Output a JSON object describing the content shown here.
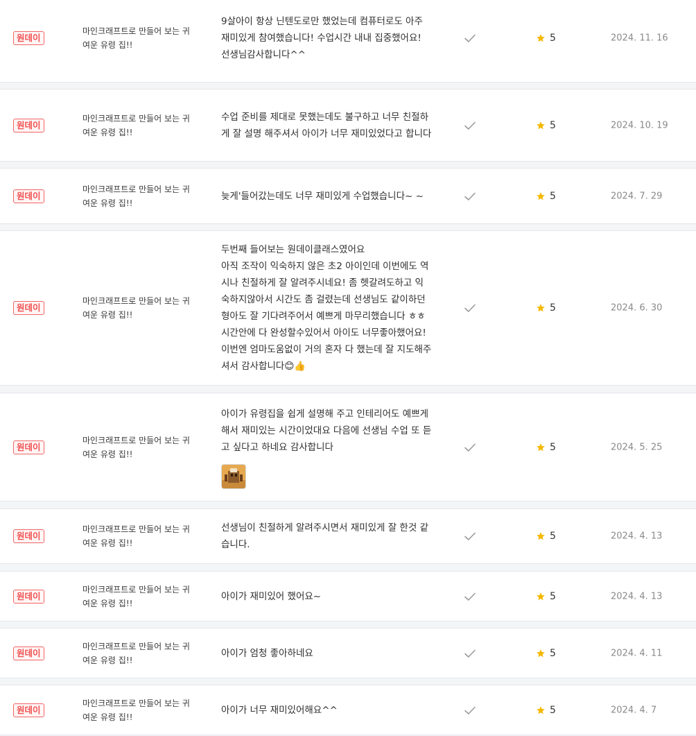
{
  "reviews": [
    {
      "badge": "원데이",
      "title": "마인크래프트로 만들어 보는 귀여운 유령 집!!",
      "text": [
        "9살아이 항상 닌텐도로만 했었는데 컴퓨터로도 아주 재미있게 참여했습니다! 수업시간 내내 집중했어요!",
        "선생님감사합니다^^"
      ],
      "rating": "5",
      "date": "2024. 11. 16",
      "has_image": false
    },
    {
      "badge": "원데이",
      "title": "마인크래프트로 만들어 보는 귀여운 유령 집!!",
      "text": [
        "수업 준비를 제대로 못했는데도 불구하고 너무 친절하게 잘 설명 해주셔서 아이가 너무 재미있었다고 합니다"
      ],
      "rating": "5",
      "date": "2024. 10. 19",
      "has_image": false
    },
    {
      "badge": "원데이",
      "title": "마인크래프트로 만들어 보는 귀여운 유령 집!!",
      "text": [
        "늦게'들어갔는데도 너무 재미있게 수업했습니다~ ~"
      ],
      "rating": "5",
      "date": "2024. 7. 29",
      "has_image": false
    },
    {
      "badge": "원데이",
      "title": "마인크래프트로 만들어 보는 귀여운 유령 집!!",
      "text": [
        "두번째 들어보는 원데이클래스였어요",
        "아직 조작이 익숙하지 않은 초2 아이인데 이번에도 역시나 친절하게 잘 알려주시네요! 좀 헷갈려도하고 익숙하지않아서 시간도 좀 걸렸는데 선생님도 같이하던 형아도 잘 기다려주어서 예쁘게 마무리했습니다 ㅎㅎ 시간안에 다 완성할수있어서 아이도 너무좋아했어요! 이번엔 엄마도움없이 거의 혼자 다 했는데 잘 지도해주셔서 감사합니다😊👍"
      ],
      "rating": "5",
      "date": "2024. 6. 30",
      "has_image": false
    },
    {
      "badge": "원데이",
      "title": "마인크래프트로 만들어 보는 귀여운 유령 집!!",
      "text": [
        "아이가 유령집을 쉽게 설명해 주고 인테리어도 예쁘게 해서 재미있는 시간이었대요 다음에 선생님 수업 또 듣고 싶다고 하네요 감사합니다"
      ],
      "rating": "5",
      "date": "2024. 5. 25",
      "has_image": true
    },
    {
      "badge": "원데이",
      "title": "마인크래프트로 만들어 보는 귀여운 유령 집!!",
      "text": [
        "선생님이 친절하게 알려주시면서 재미있게 잘 한것 같습니다."
      ],
      "rating": "5",
      "date": "2024. 4. 13",
      "has_image": false
    },
    {
      "badge": "원데이",
      "title": "마인크래프트로 만들어 보는 귀여운 유령 집!!",
      "text": [
        "아이가 재미있어 했어요~"
      ],
      "rating": "5",
      "date": "2024. 4. 13",
      "has_image": false
    },
    {
      "badge": "원데이",
      "title": "마인크래프트로 만들어 보는 귀여운 유령 집!!",
      "text": [
        "아이가 엄청 좋아하네요"
      ],
      "rating": "5",
      "date": "2024. 4. 11",
      "has_image": false
    },
    {
      "badge": "원데이",
      "title": "마인크래프트로 만들어 보는 귀여운 유령 집!!",
      "text": [
        "아이가 너무 재미있어해요^^"
      ],
      "rating": "5",
      "date": "2024. 4. 7",
      "has_image": false
    }
  ],
  "colors": {
    "badge": "#f25050",
    "star": "#f5b800",
    "check": "#9a9a9a",
    "date": "#8a8a8a"
  },
  "icons": {
    "check": "check-icon",
    "star": "star-icon",
    "thumbnail": "review-photo-thumbnail"
  }
}
